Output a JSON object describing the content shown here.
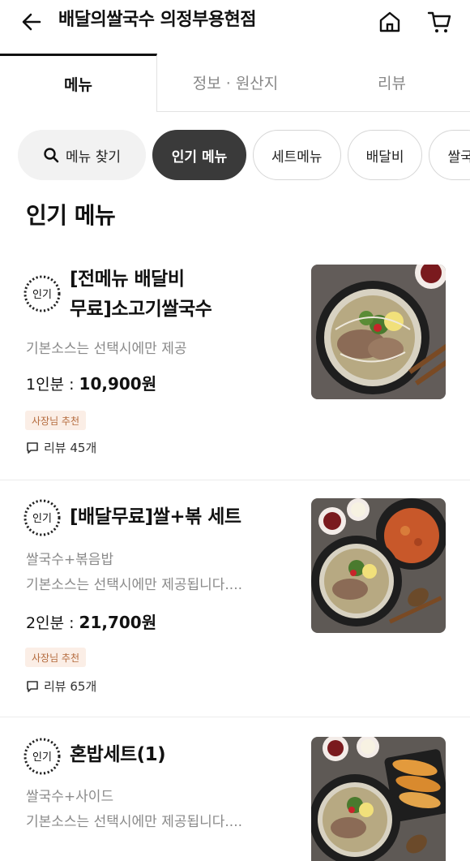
{
  "header": {
    "store_name": "배달의쌀국수 의정부용현점",
    "back_icon": "arrow-left-icon",
    "home_icon": "home-icon",
    "cart_icon": "cart-icon"
  },
  "tabs": [
    {
      "label": "메뉴",
      "active": true
    },
    {
      "label": "정보 · 원산지",
      "active": false
    },
    {
      "label": "리뷰",
      "active": false
    }
  ],
  "chips": {
    "search_label": "메뉴 찾기",
    "items": [
      {
        "label": "인기 메뉴",
        "active": true
      },
      {
        "label": "세트메뉴",
        "active": false
      },
      {
        "label": "배달비",
        "active": false
      },
      {
        "label": "쌀국",
        "active": false
      }
    ]
  },
  "section": {
    "title": "인기 메뉴"
  },
  "popular_badge_text": "인기",
  "menu_items": [
    {
      "name_line1": "[전메뉴 배달비",
      "name_line2": "무료]소고기쌀국수",
      "desc_line1": "기본소스는 선택시에만 제공",
      "desc_line2": "",
      "price_label": "1인분 : ",
      "price_value": "10,900원",
      "owner_badge": "사장님 추천",
      "review": "리뷰 45개"
    },
    {
      "name_line1": "[배달무료]쌀+볶 세트",
      "name_line2": "",
      "desc_line1": "쌀국수+볶음밥",
      "desc_line2": "기본소스는 선택시에만 제공됩니다....",
      "price_label": "2인분 : ",
      "price_value": "21,700원",
      "owner_badge": "사장님 추천",
      "review": "리뷰 65개"
    },
    {
      "name_line1": "혼밥세트(1)",
      "name_line2": "",
      "desc_line1": "쌀국수+사이드",
      "desc_line2": "기본소스는 선택시에만 제공됩니다....",
      "price_label": "",
      "price_value": "",
      "owner_badge": "",
      "review": ""
    }
  ],
  "colors": {
    "active_chip": "#3a3a3a",
    "owner_badge_bg": "#fbeee6",
    "owner_badge_text": "#b46a3c",
    "muted_text": "#8a8a8a"
  }
}
